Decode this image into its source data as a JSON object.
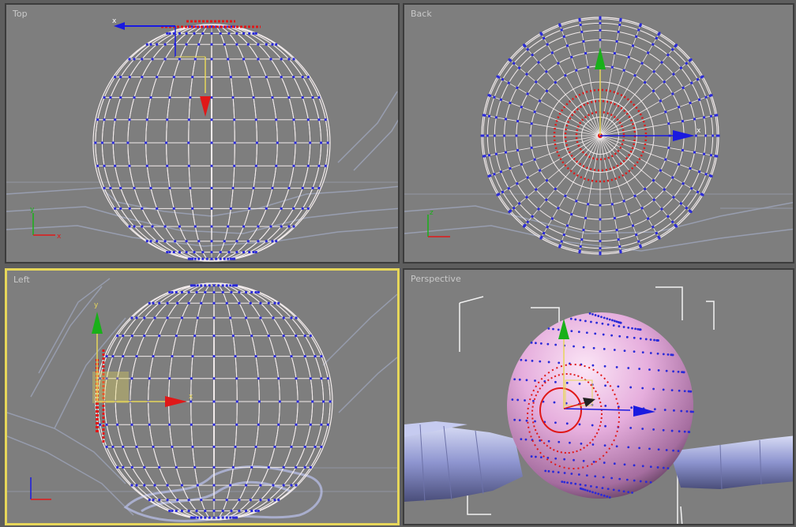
{
  "viewports": {
    "top": {
      "label": "Top"
    },
    "back": {
      "label": "Back"
    },
    "left": {
      "label": "Left"
    },
    "perspective": {
      "label": "Perspective"
    }
  },
  "axes": {
    "x": "x",
    "y": "y",
    "z": "z"
  },
  "colors": {
    "background": "#7e7e7e",
    "active_border": "#e6d65a",
    "wire": "#f3ecec",
    "vertex": "#2a2ad8",
    "selected_vertex": "#e01818",
    "x_axis": "#1a1ae0",
    "y_axis": "#19b019",
    "z_axis": "#e01818",
    "sphere": "#e8b6e0"
  },
  "icons": [
    "move-gizmo-icon",
    "axis-tripod-icon"
  ]
}
